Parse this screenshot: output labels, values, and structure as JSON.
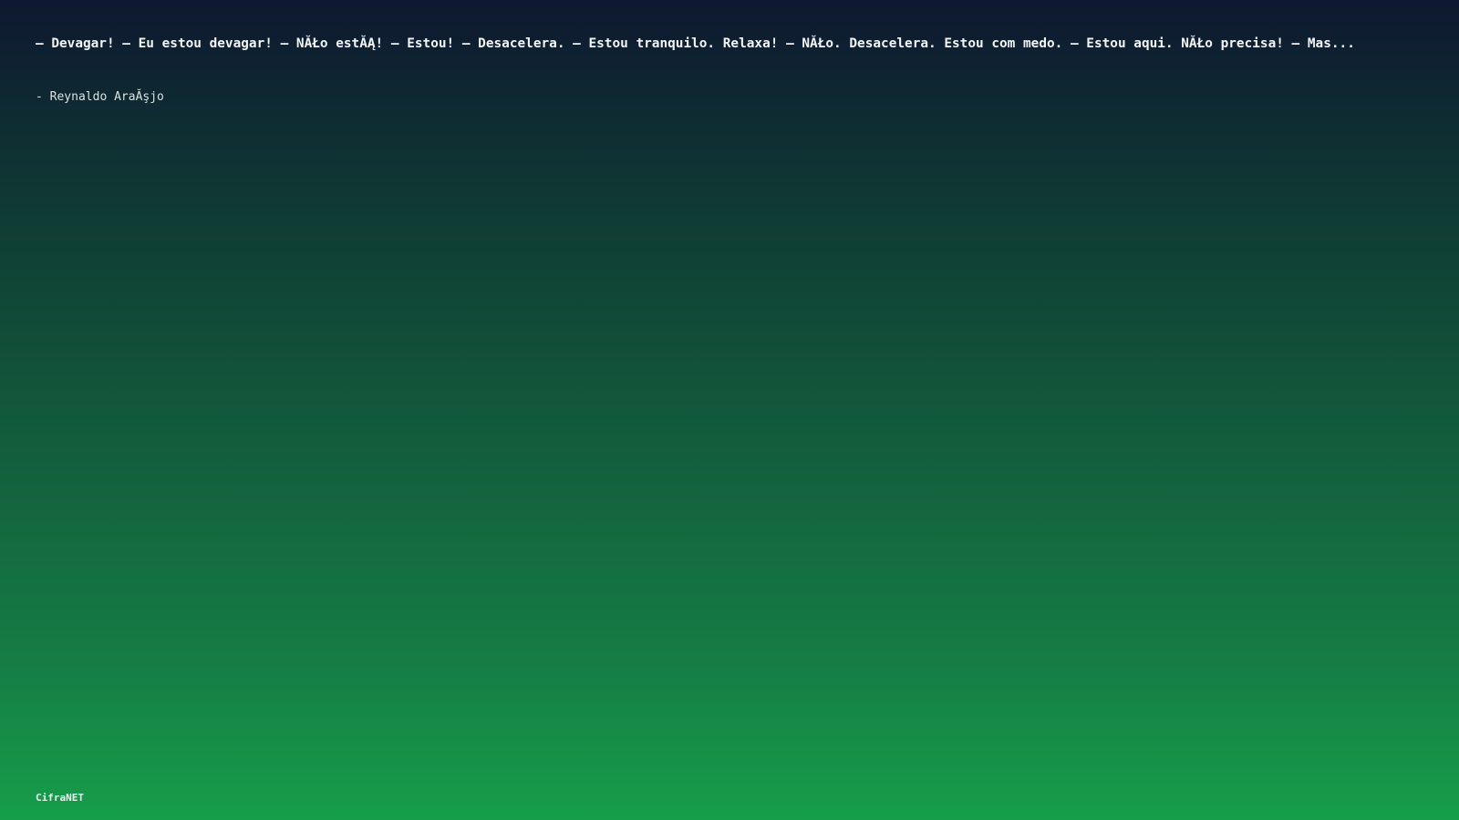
{
  "quote": {
    "text": "– Devagar! – Eu estou devagar! – NĂŁo estĂĄ! – Estou! – Desacelera. – Estou tranquilo. Relaxa! – NĂŁo. Desacelera. Estou com medo. – Estou aqui. NĂŁo precisa! – Mas...",
    "author": "- Reynaldo AraĂşjo"
  },
  "footer": {
    "brand": "CifraNET"
  },
  "colors": {
    "background_top": "#0e1830",
    "background_bottom": "#169e4a",
    "text": "#f2f5f4"
  }
}
